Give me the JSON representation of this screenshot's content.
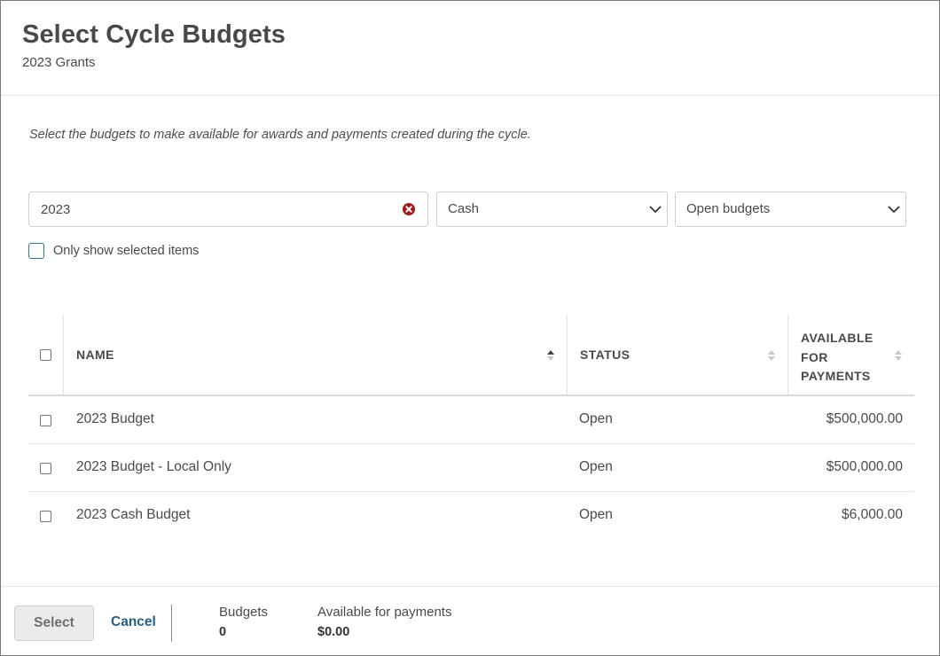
{
  "header": {
    "title": "Select Cycle Budgets",
    "subtitle": "2023 Grants"
  },
  "instructions": "Select the budgets to make available for awards and payments created during the cycle.",
  "filters": {
    "search_value": "2023",
    "type_select": "Cash",
    "status_select": "Open budgets",
    "only_selected_label": "Only show selected items",
    "only_selected_checked": false
  },
  "table": {
    "columns": {
      "name": "NAME",
      "status": "STATUS",
      "available_line1": "AVAILABLE",
      "available_line2": "FOR",
      "available_line3": "PAYMENTS"
    },
    "rows": [
      {
        "name": "2023 Budget",
        "status": "Open",
        "available": "$500,000.00"
      },
      {
        "name": "2023 Budget - Local Only",
        "status": "Open",
        "available": "$500,000.00"
      },
      {
        "name": "2023 Cash Budget",
        "status": "Open",
        "available": "$6,000.00"
      }
    ]
  },
  "footer": {
    "select_label": "Select",
    "cancel_label": "Cancel",
    "budgets_label": "Budgets",
    "budgets_count": "0",
    "available_label": "Available for payments",
    "available_value": "$0.00"
  },
  "colors": {
    "accent_link": "#25607f",
    "checkbox_border": "#3a6f8a",
    "clear_icon": "#a01c1c",
    "disabled_button_bg": "#ebebeb"
  },
  "icons": {
    "clear": "x-circle-icon",
    "dropdown": "chevron-down-icon",
    "sort_asc": "sort-ascending-icon",
    "sort": "sort-icon"
  }
}
